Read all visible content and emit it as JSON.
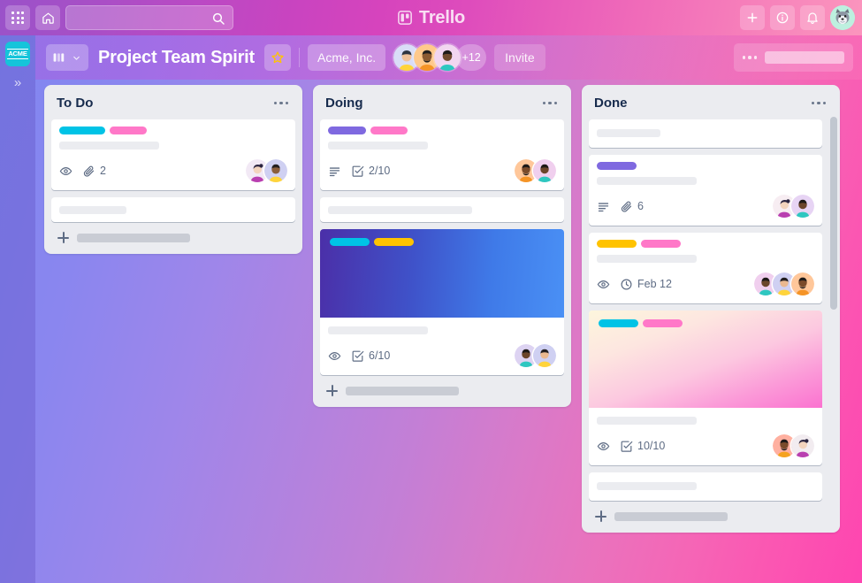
{
  "topnav": {
    "apps_icon": "grid-apps-icon",
    "home_icon": "home-icon",
    "search": {
      "value": "",
      "placeholder": ""
    },
    "brand": {
      "logo_icon": "trello-board-logo",
      "name": "Trello"
    },
    "add_icon": "plus-icon",
    "info_icon": "info-circle-icon",
    "notifications_icon": "bell-icon",
    "avatar": {
      "name": "user-avatar-husky"
    }
  },
  "sidebar": {
    "workspace_tile": {
      "label": "ACME",
      "color": "#15c4da"
    },
    "expand_icon": "chevron-double-right-icon",
    "expand_label": "»"
  },
  "boardbar": {
    "switcher_icon": "board-switcher-icon",
    "switcher_caret": "chevron-down-icon",
    "title": "Project Team Spirit",
    "star_icon": "star-icon",
    "organization": "Acme, Inc.",
    "members": [
      {
        "name": "member-avatar-1"
      },
      {
        "name": "member-avatar-2"
      },
      {
        "name": "member-avatar-3"
      }
    ],
    "members_overflow": "+12",
    "invite_label": "Invite",
    "menu_dots": "board-menu-dots-icon"
  },
  "theme": {
    "background_left": "#7f87f0",
    "background_right": "#fe45b0",
    "list_bg": "#ebecf0",
    "card_bg": "#ffffff",
    "text_dark": "#172b4d",
    "text_muted": "#5e6c84",
    "label_cyan": "#00c3e6",
    "label_pink": "#ff78c8",
    "label_purple": "#7f69e0",
    "label_yellow": "#ffc300"
  },
  "lists": [
    {
      "id": "todo",
      "title": "To Do",
      "menu_icon": "list-menu-dots-icon",
      "add_card_label": "",
      "has_scrollbar": false,
      "cards": [
        {
          "id": "todo-card-1",
          "type": "plain",
          "labels": [
            {
              "color": "#00c3e6",
              "width": 52,
              "dotted": false
            },
            {
              "color": "#ff78c8",
              "width": 42,
              "dotted": false
            }
          ],
          "title_ghost_width": 113,
          "badges": [
            {
              "icon": "eye-icon",
              "text": ""
            },
            {
              "icon": "attachment-icon",
              "text": "2"
            }
          ],
          "members": [
            {
              "name": "card-avatar-woman-magenta"
            },
            {
              "name": "card-avatar-person-yellow"
            }
          ]
        },
        {
          "id": "todo-card-2",
          "type": "plain",
          "labels": [],
          "title_ghost_width": 76,
          "badges": [],
          "members": []
        }
      ]
    },
    {
      "id": "doing",
      "title": "Doing",
      "menu_icon": "list-menu-dots-icon",
      "add_card_label": "",
      "has_scrollbar": false,
      "cards": [
        {
          "id": "doing-card-1",
          "type": "plain",
          "labels": [
            {
              "color": "#7f69e0",
              "width": 43,
              "dotted": true
            },
            {
              "color": "#ff78c8",
              "width": 42,
              "dotted": false
            }
          ],
          "title_ghost_width": 113,
          "badges": [
            {
              "icon": "description-icon",
              "text": ""
            },
            {
              "icon": "checklist-icon",
              "text": "2/10"
            }
          ],
          "members": [
            {
              "name": "card-avatar-man-beard-orange"
            },
            {
              "name": "card-avatar-person-teal"
            }
          ]
        },
        {
          "id": "doing-card-2",
          "type": "plain",
          "labels": [],
          "title_ghost_width": 163,
          "badges": [],
          "members": []
        },
        {
          "id": "doing-card-3",
          "type": "cover",
          "cover": {
            "name": "cover-gradient-blue",
            "from": "#4b2fa8",
            "to": "#4a90f5"
          },
          "labels": [
            {
              "color": "#00c3e6",
              "width": 45,
              "dotted": false
            },
            {
              "color": "#ffc300",
              "width": 45,
              "dotted": false
            }
          ],
          "title_ghost_width": 113,
          "badges": [
            {
              "icon": "eye-icon",
              "text": ""
            },
            {
              "icon": "checklist-icon",
              "text": "6/10"
            }
          ],
          "members": [
            {
              "name": "card-avatar-person-teal"
            },
            {
              "name": "card-avatar-person-yellow"
            }
          ]
        }
      ]
    },
    {
      "id": "done",
      "title": "Done",
      "menu_icon": "list-menu-dots-icon",
      "add_card_label": "",
      "has_scrollbar": true,
      "cards": [
        {
          "id": "done-card-1",
          "type": "plain",
          "labels": [],
          "title_ghost_width": 72,
          "badges": [],
          "members": []
        },
        {
          "id": "done-card-2",
          "type": "plain",
          "labels": [
            {
              "color": "#7f69e0",
              "width": 45,
              "dotted": false
            }
          ],
          "title_ghost_width": 113,
          "badges": [
            {
              "icon": "description-icon",
              "text": ""
            },
            {
              "icon": "attachment-icon",
              "text": "6"
            }
          ],
          "members": [
            {
              "name": "card-avatar-woman-magenta"
            },
            {
              "name": "card-avatar-person-teal"
            }
          ]
        },
        {
          "id": "done-card-3",
          "type": "plain",
          "labels": [
            {
              "color": "#ffc300",
              "width": 45,
              "dotted": false
            },
            {
              "color": "#ff78c8",
              "width": 45,
              "dotted": false
            }
          ],
          "title_ghost_width": 113,
          "badges": [
            {
              "icon": "eye-icon",
              "text": ""
            },
            {
              "icon": "clock-icon",
              "text": "Feb 12"
            }
          ],
          "members": [
            {
              "name": "card-avatar-person-teal"
            },
            {
              "name": "card-avatar-person-yellow"
            },
            {
              "name": "card-avatar-man-beard-orange"
            }
          ]
        },
        {
          "id": "done-card-4",
          "type": "cover",
          "cover": {
            "name": "cover-gradient-pink",
            "from": "#fdf3d9",
            "to": "#fb72d0"
          },
          "labels": [
            {
              "color": "#00c3e6",
              "width": 45,
              "dotted": false
            },
            {
              "color": "#ff78c8",
              "width": 45,
              "dotted": false
            }
          ],
          "title_ghost_width": 113,
          "badges": [
            {
              "icon": "eye-icon",
              "text": ""
            },
            {
              "icon": "checklist-icon",
              "text": "10/10"
            }
          ],
          "members": [
            {
              "name": "card-avatar-man-beard-orange"
            },
            {
              "name": "card-avatar-woman-magenta"
            }
          ]
        },
        {
          "id": "done-card-5",
          "type": "plain",
          "labels": [],
          "title_ghost_width": 113,
          "badges": [],
          "members": []
        }
      ]
    }
  ]
}
